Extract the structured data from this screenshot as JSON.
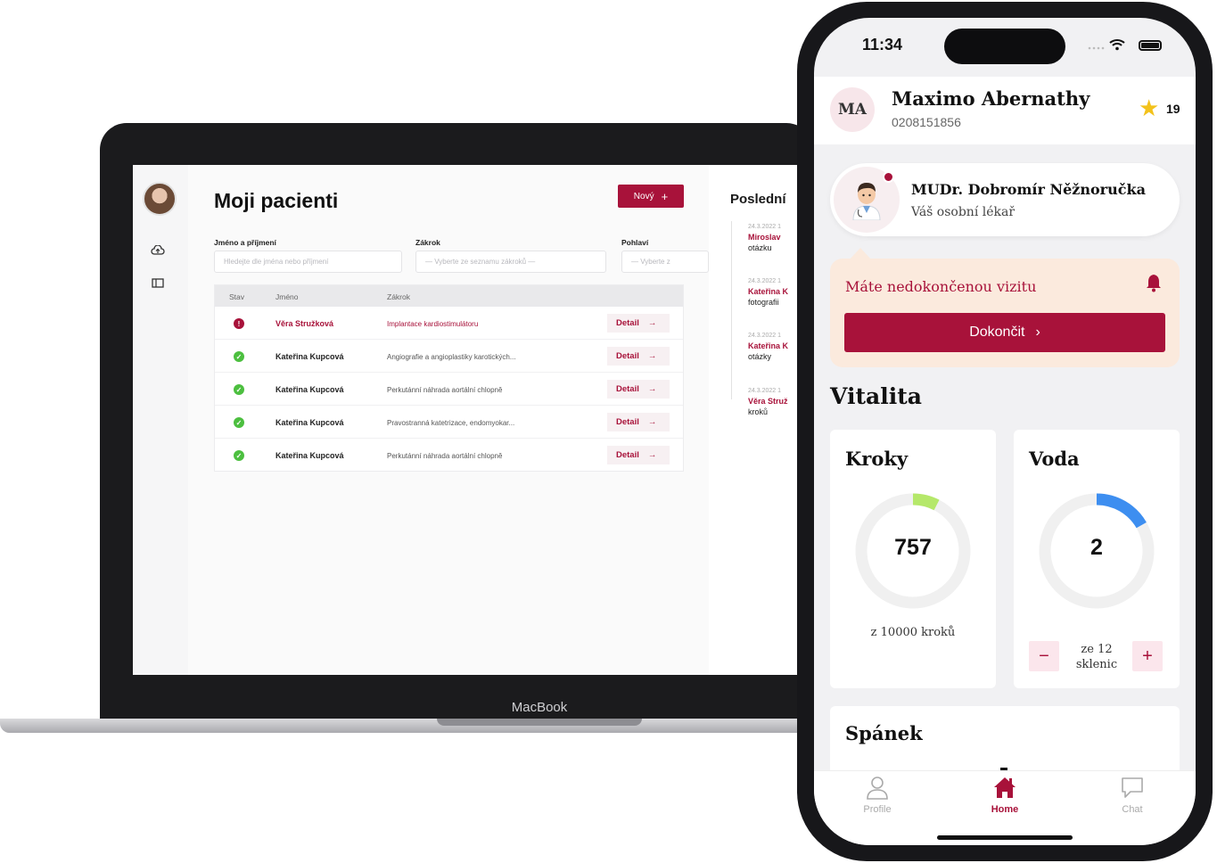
{
  "laptop": {
    "brand": "MacBook",
    "app": {
      "page_title": "Moji pacienti",
      "new_button": "Nový",
      "filters": {
        "name_label": "Jméno a příjmení",
        "name_placeholder": "Hledejte dle jména nebo příjmení",
        "procedure_label": "Zákrok",
        "procedure_placeholder": "— Vyberte ze seznamu zákroků —",
        "gender_label": "Pohlaví",
        "gender_placeholder": "— Vyberte z"
      },
      "table": {
        "headers": [
          "Stav",
          "Jméno",
          "Zákrok"
        ],
        "detail_label": "Detail",
        "rows": [
          {
            "status": "error",
            "name": "Věra Stružková",
            "procedure": "Implantace kardiostimulátoru"
          },
          {
            "status": "ok",
            "name": "Kateřina Kupcová",
            "procedure": "Angiografie a angioplastiky karotických..."
          },
          {
            "status": "ok",
            "name": "Kateřina Kupcová",
            "procedure": "Perkutánní náhrada aortální chlopně"
          },
          {
            "status": "ok",
            "name": "Kateřina Kupcová",
            "procedure": "Pravostranná katetrizace, endomyokar..."
          },
          {
            "status": "ok",
            "name": "Kateřina Kupcová",
            "procedure": "Perkutánní náhrada aortální chlopně"
          }
        ]
      },
      "side": {
        "title": "Poslední",
        "items": [
          {
            "date": "24.3.2022 1",
            "who": "Miroslav",
            "what": "otázku"
          },
          {
            "date": "24.3.2022 1",
            "who": "Kateřina K",
            "what": "fotografii"
          },
          {
            "date": "24.3.2022 1",
            "who": "Kateřina K",
            "what": "otázky"
          },
          {
            "date": "24.3.2022 1",
            "who": "Věra Struž",
            "what": "kroků"
          }
        ]
      }
    }
  },
  "phone": {
    "status_time": "11:34",
    "user": {
      "initials": "MA",
      "name": "Maximo Abernathy",
      "id": "0208151856",
      "stars": "19"
    },
    "doctor": {
      "name": "MUDr. Dobromír Něžnoručka",
      "role": "Váš osobní lékař"
    },
    "alert": {
      "text": "Máte nedokončenou vizitu",
      "button": "Dokončit"
    },
    "vitality_title": "Vitalita",
    "steps": {
      "title": "Kroky",
      "value": "757",
      "goal_text": "z 10000 kroků",
      "current": 757,
      "goal": 10000
    },
    "water": {
      "title": "Voda",
      "value": "2",
      "goal_text": "ze 12 sklenic",
      "goal_line1": "ze 12",
      "goal_line2": "sklenic",
      "current": 2,
      "goal": 12
    },
    "sleep_title": "Spánek",
    "tabs": [
      {
        "label": "Profile",
        "icon": "person-icon",
        "active": false
      },
      {
        "label": "Home",
        "icon": "home-icon",
        "active": true
      },
      {
        "label": "Chat",
        "icon": "chat-icon",
        "active": false
      }
    ],
    "colors": {
      "accent": "#a8123a",
      "steps_ring": "#b5e86a",
      "water_ring": "#3d8ef0",
      "ring_track": "#f0f0f0",
      "alert_bg": "#fbeadd"
    }
  }
}
